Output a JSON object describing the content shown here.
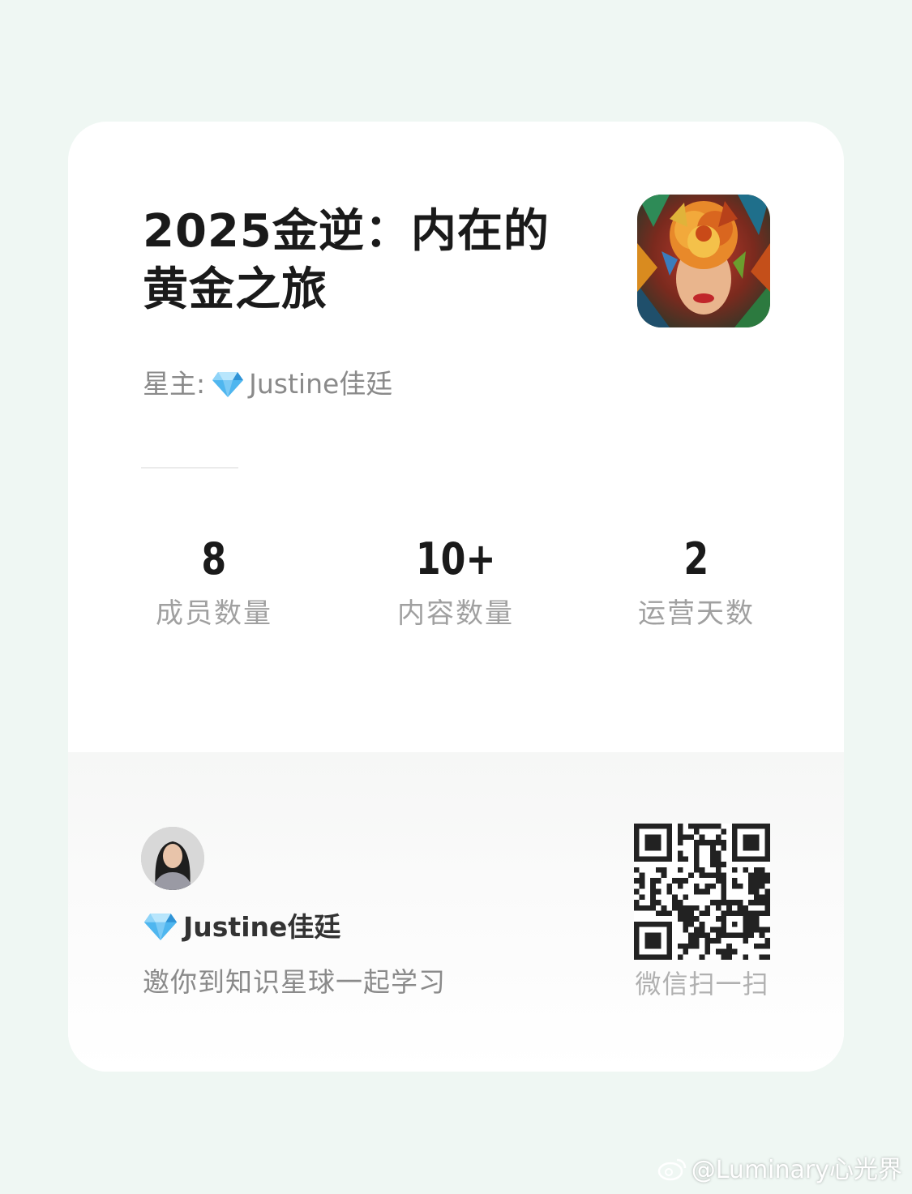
{
  "card": {
    "title": "2025金逆：内在的黄金之旅",
    "owner_prefix": "星主:",
    "owner_name": "Justine佳廷",
    "cover_icon": "mosaic-portrait-cover-image"
  },
  "stats": [
    {
      "value": "8",
      "label": "成员数量"
    },
    {
      "value": "10+",
      "label": "内容数量"
    },
    {
      "value": "2",
      "label": "运营天数"
    }
  ],
  "footer": {
    "inviter_name": "Justine佳廷",
    "invite_text": "邀你到知识星球一起学习",
    "qr_label": "微信扫一扫",
    "qr_icon": "qr-code"
  },
  "watermark": {
    "text": "@Luminary心光界",
    "icon": "weibo-icon"
  },
  "colors": {
    "background": "#eff7f3",
    "card": "#ffffff",
    "title": "#1a1a1a",
    "muted": "#8a8a8a",
    "gem": "#3aa7e8"
  }
}
